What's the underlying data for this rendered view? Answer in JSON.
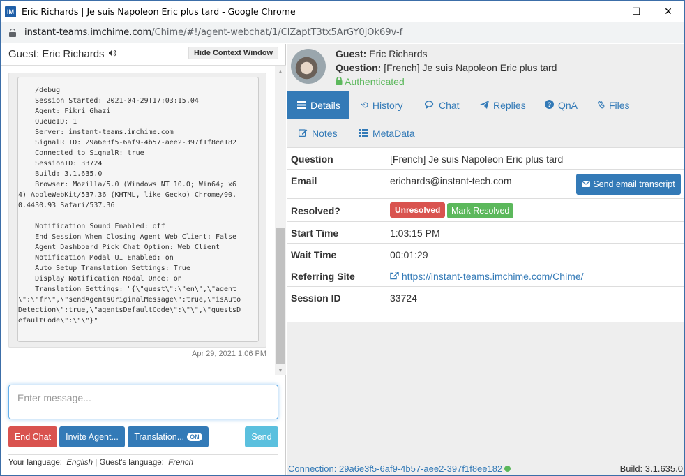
{
  "window": {
    "title": "Eric Richards | Je suis Napoleon Eric plus tard - Google Chrome",
    "app_icon": "IM",
    "controls": {
      "minimize": "—",
      "maximize": "☐",
      "close": "✕"
    }
  },
  "address": {
    "host": "instant-teams.imchime.com",
    "path": "/Chime/#!/agent-webchat/1/ClZaptT3tx5ArGY0jOk69v-f"
  },
  "left": {
    "guest_title": "Guest: Eric Richards",
    "hide_context_label": "Hide Context Window",
    "debug_text": "    /debug\n    Session Started: 2021-04-29T17:03:15.04\n    Agent: Fikri Ghazi\n    QueueID: 1\n    Server: instant-teams.imchime.com\n    SignalR ID: 29a6e3f5-6af9-4b57-aee2-397f1f8ee182\n    Connected to SignalR: true\n    SessionID: 33724\n    Build: 3.1.635.0\n    Browser: Mozilla/5.0 (Windows NT 10.0; Win64; x6\n4) AppleWebKit/537.36 (KHTML, like Gecko) Chrome/90.\n0.4430.93 Safari/537.36\n\n    Notification Sound Enabled: off\n    End Session When Closing Agent Web Client: False\n    Agent Dashboard Pick Chat Option: Web Client\n    Notification Modal UI Enabled: on\n    Auto Setup Translation Settings: True\n    Display Notification Modal Once: on\n    Translation Settings: \"{\\\"guest\\\":\\\"en\\\",\\\"agent\n\\\":\\\"fr\\\",\\\"sendAgentsOriginalMessage\\\":true,\\\"isAuto\nDetection\\\":true,\\\"agentsDefaultCode\\\":\\\"\\\",\\\"guestsD\nefaultCode\\\":\\\"\\\"}\"",
    "message_time": "Apr 29, 2021 1:06 PM",
    "compose_placeholder": "Enter message...",
    "buttons": {
      "end_chat": "End Chat",
      "invite_agent": "Invite Agent...",
      "translation": "Translation...",
      "translation_state": "ON",
      "send": "Send"
    },
    "language": {
      "your_label": "Your language:",
      "your_value": "English",
      "sep": "|",
      "guest_label": "Guest's language:",
      "guest_value": "French"
    }
  },
  "right": {
    "guest_label": "Guest:",
    "guest_name": "Eric Richards",
    "question_label": "Question:",
    "question_text": "[French] Je suis Napoleon Eric plus tard",
    "authenticated": "Authenticated",
    "tabs": [
      {
        "label": "Details",
        "icon": "list-icon"
      },
      {
        "label": "History",
        "icon": "history-icon"
      },
      {
        "label": "Chat",
        "icon": "chat-icon"
      },
      {
        "label": "Replies",
        "icon": "send-icon"
      },
      {
        "label": "QnA",
        "icon": "question-icon"
      },
      {
        "label": "Files",
        "icon": "paperclip-icon"
      },
      {
        "label": "Notes",
        "icon": "edit-icon"
      },
      {
        "label": "MetaData",
        "icon": "list-alt-icon"
      }
    ],
    "details": {
      "question": {
        "label": "Question",
        "value": "[French] Je suis Napoleon Eric plus tard"
      },
      "email": {
        "label": "Email",
        "value": "erichards@instant-tech.com",
        "button": "Send email transcript"
      },
      "resolved": {
        "label": "Resolved?",
        "badge": "Unresolved",
        "button": "Mark Resolved"
      },
      "start_time": {
        "label": "Start Time",
        "value": "1:03:15 PM"
      },
      "wait_time": {
        "label": "Wait Time",
        "value": "00:01:29"
      },
      "referring_site": {
        "label": "Referring Site",
        "value": "https://instant-teams.imchime.com/Chime/"
      },
      "session_id": {
        "label": "Session ID",
        "value": "33724"
      }
    },
    "footer": {
      "connection": "Connection: 29a6e3f5-6af9-4b57-aee2-397f1f8ee182",
      "build": "Build: 3.1.635.0"
    }
  },
  "colors": {
    "primary": "#337ab7",
    "danger": "#d9534f",
    "success": "#5cb85c",
    "info": "#5bc0de"
  }
}
